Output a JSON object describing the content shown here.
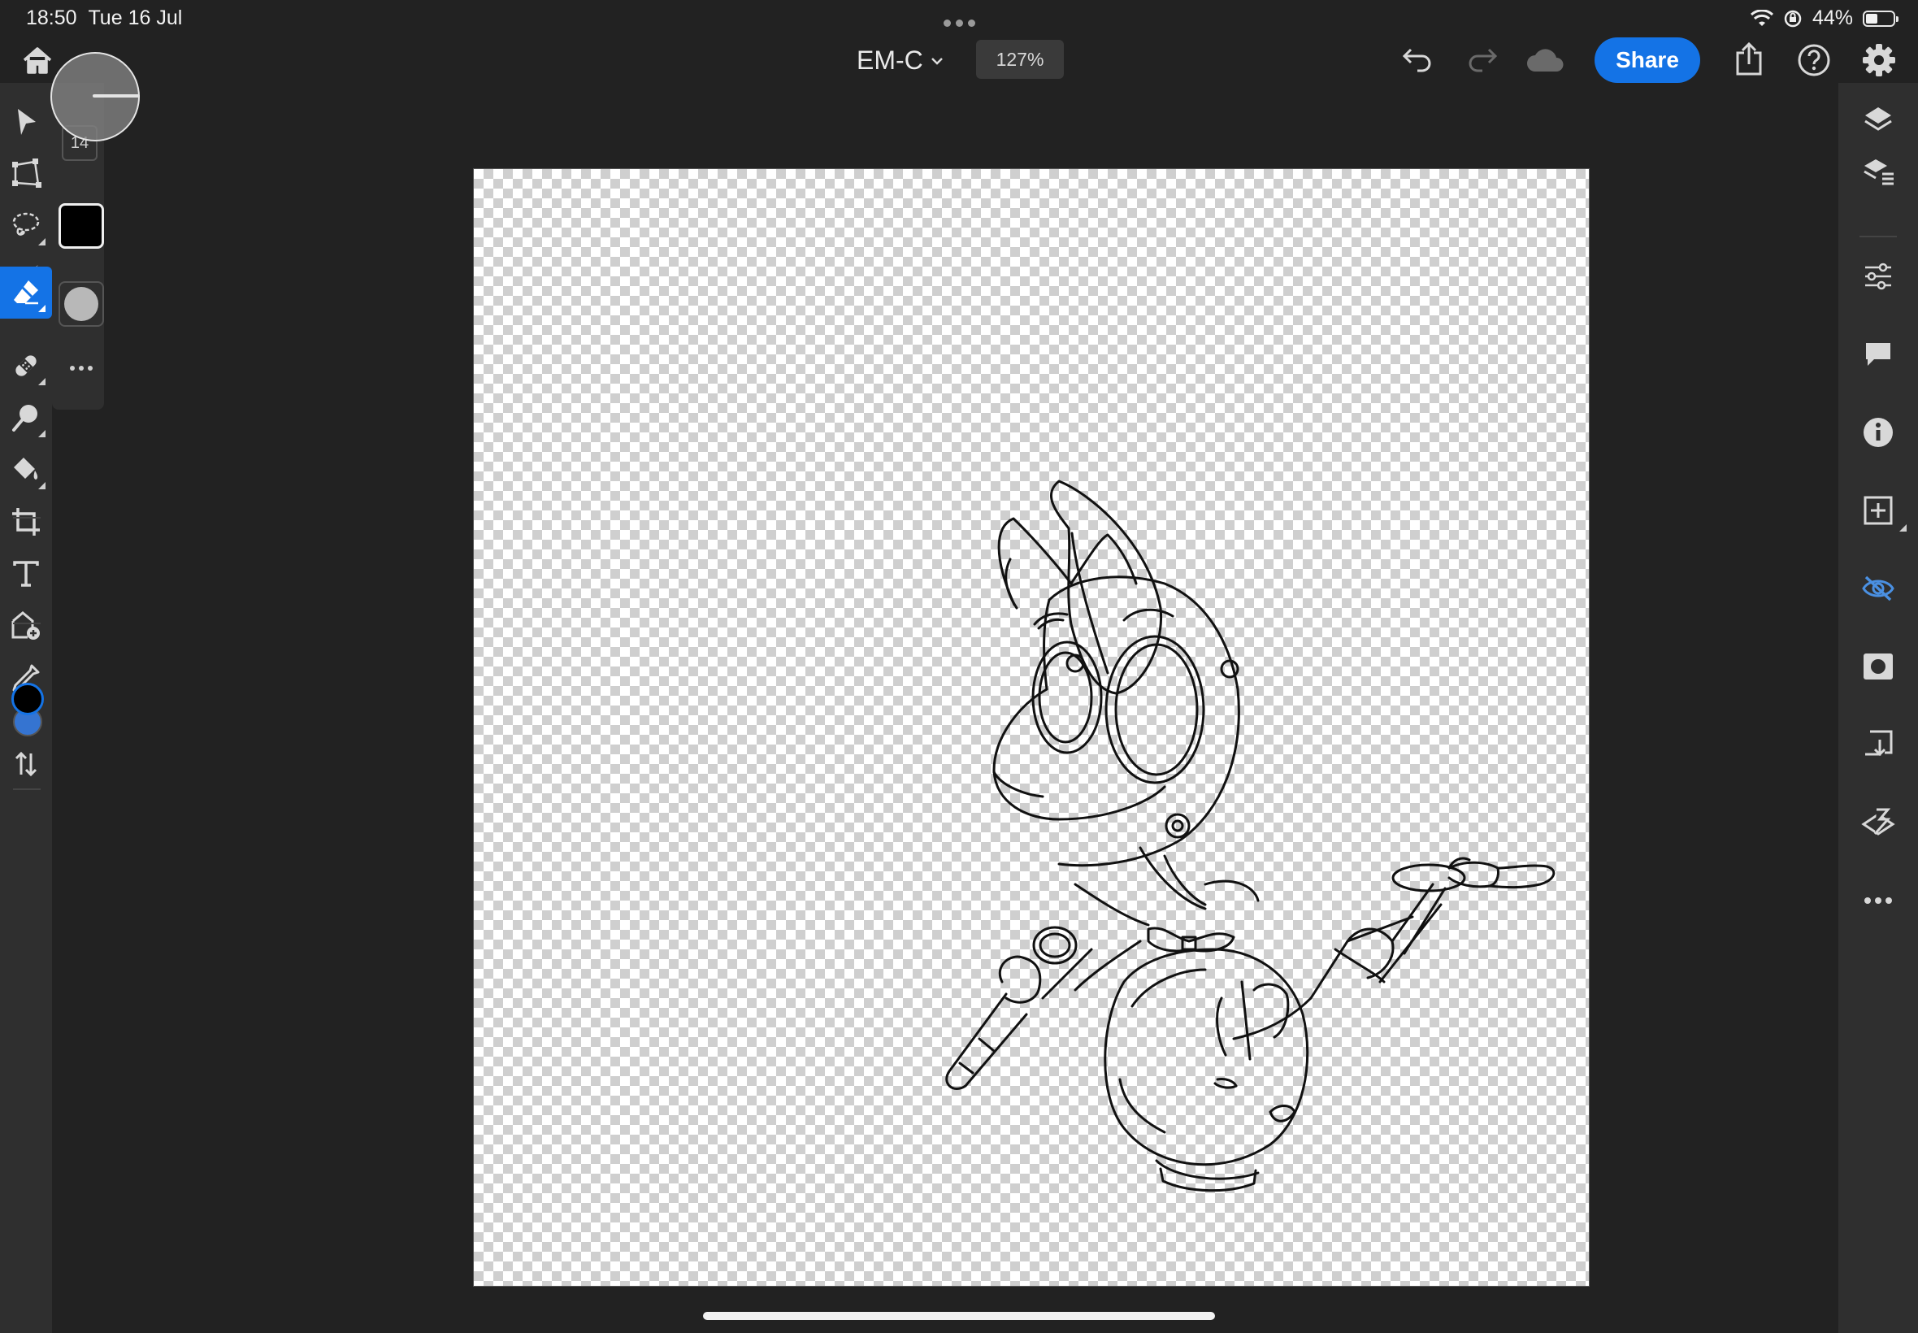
{
  "status_bar": {
    "time": "18:50",
    "date": "Tue 16 Jul",
    "battery_text": "44%",
    "battery_level": 0.44
  },
  "top_bar": {
    "document_title": "EM-C",
    "zoom_level": "127%",
    "share_label": "Share",
    "icons": [
      "home-icon",
      "undo-icon",
      "redo-icon",
      "cloud-icon",
      "export-icon",
      "help-icon",
      "settings-icon"
    ]
  },
  "left_toolbar": {
    "tools": [
      "select-icon",
      "transform-icon",
      "lasso-icon",
      "brush-icon",
      "eraser-icon",
      "healing-icon",
      "smudge-icon",
      "fill-icon",
      "crop-icon",
      "type-icon",
      "place-image-icon",
      "eyedropper-icon",
      "swap-colors-icon"
    ],
    "active_tool": "eraser",
    "primary_color": "#000000",
    "secondary_color": "#3574d1",
    "accent_color": "#1473e6"
  },
  "tool_options": {
    "brush_size": "14",
    "eraser_color": "#000000",
    "softness_swatch": "#b8b8b8"
  },
  "right_toolbar": {
    "tools": [
      "layers-icon",
      "layer-properties-icon",
      "adjustments-icon",
      "comments-icon",
      "info-icon",
      "add-layer-icon",
      "visibility-icon",
      "mask-icon",
      "import-icon",
      "clipping-icon",
      "more-icon"
    ]
  }
}
